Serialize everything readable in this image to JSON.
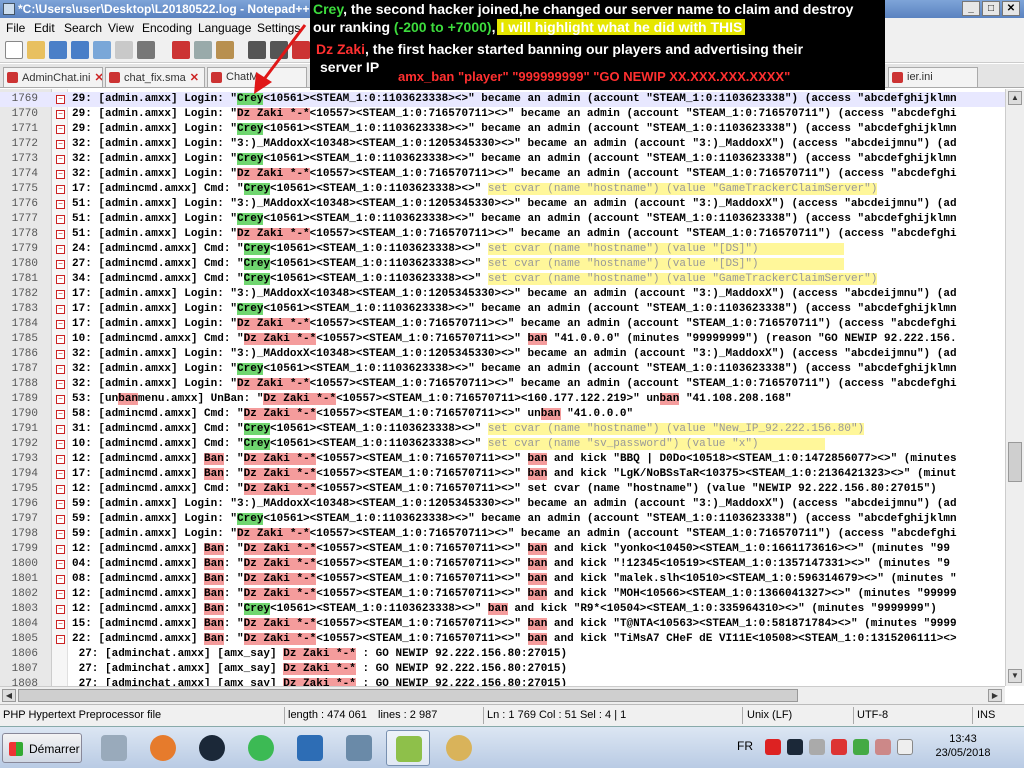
{
  "window": {
    "title": "*C:\\Users\\user\\Desktop\\L20180522.log - Notepad++",
    "min": "_",
    "max": "□",
    "close": "✕"
  },
  "menu": [
    "File",
    "Edit",
    "Search",
    "View",
    "Encoding",
    "Language",
    "Settings"
  ],
  "tabs": [
    {
      "label": "AdminChat.ini"
    },
    {
      "label": "chat_fix.sma"
    },
    {
      "label": "ChatM"
    },
    {
      "label": "ier.ini"
    }
  ],
  "annotation": {
    "line1_name": "Crey",
    "line1_text": ", the second hacker joined,he changed our server name to claim and destroy",
    "line2_pre": "our ranking ",
    "line2_range": "(-200 to +7000)",
    "line2_comma": ",",
    "line2_box": "I will highlight what he did with THIS",
    "line3_name": "Dz Zaki",
    "line3_text": ", the first hacker started banning our players and advertising their",
    "line4_text": "server IP",
    "line5_cmd": "amx_ban \"player\" \"999999999\" \"GO NEWIP XX.XXX.XXX.XXXX\""
  },
  "editor": {
    "lines": [
      {
        "n": "1769",
        "segs": [
          [
            "29: [admin.amxx] Login: \"",
            ""
          ],
          [
            "Crey",
            "g"
          ],
          [
            "<10561><STEAM_1:0:1103623338><>\" became an admin (account \"STEAM_1:0:1103623338\") (access \"abcdefghijklmn",
            ""
          ]
        ]
      },
      {
        "n": "1770",
        "segs": [
          [
            "29: [admin.amxx] Login: \"",
            ""
          ],
          [
            "Dz Zaki *-*",
            "r"
          ],
          [
            "<10557><STEAM_1:0:716570711><>\" became an admin (account \"STEAM_1:0:716570711\") (access \"abcdefghi",
            ""
          ]
        ]
      },
      {
        "n": "1771",
        "segs": [
          [
            "29: [admin.amxx] Login: \"",
            ""
          ],
          [
            "Crey",
            "g"
          ],
          [
            "<10561><STEAM_1:0:1103623338><>\" became an admin (account \"STEAM_1:0:1103623338\") (access \"abcdefghijklmn",
            ""
          ]
        ]
      },
      {
        "n": "1772",
        "segs": [
          [
            "32: [admin.amxx] Login: \"3:)_MAddoxX<10348><STEAM_1:0:1205345330><>\" became an admin (account \"3:)_MaddoxX\") (access \"abcdeijmnu\") (ad",
            ""
          ]
        ]
      },
      {
        "n": "1773",
        "segs": [
          [
            "32: [admin.amxx] Login: \"",
            ""
          ],
          [
            "Crey",
            "g"
          ],
          [
            "<10561><STEAM_1:0:1103623338><>\" became an admin (account \"STEAM_1:0:1103623338\") (access \"abcdefghijklmn",
            ""
          ]
        ]
      },
      {
        "n": "1774",
        "segs": [
          [
            "32: [admin.amxx] Login: \"",
            ""
          ],
          [
            "Dz Zaki *-*",
            "r"
          ],
          [
            "<10557><STEAM_1:0:716570711><>\" became an admin (account \"STEAM_1:0:716570711\") (access \"abcdefghi",
            ""
          ]
        ]
      },
      {
        "n": "1775",
        "segs": [
          [
            "17: [admincmd.amxx] Cmd: \"",
            ""
          ],
          [
            "Crey",
            "g"
          ],
          [
            "<10561><STEAM_1:0:1103623338><>\" ",
            ""
          ],
          [
            "set cvar (name \"hostname\") (value \"GameTrackerClaimServer\")",
            "y"
          ]
        ]
      },
      {
        "n": "1776",
        "segs": [
          [
            "51: [admin.amxx] Login: \"3:)_MAddoxX<10348><STEAM_1:0:1205345330><>\" became an admin (account \"3:)_MaddoxX\") (access \"abcdeijmnu\") (ad",
            ""
          ]
        ]
      },
      {
        "n": "1777",
        "segs": [
          [
            "51: [admin.amxx] Login: \"",
            ""
          ],
          [
            "Crey",
            "g"
          ],
          [
            "<10561><STEAM_1:0:1103623338><>\" became an admin (account \"STEAM_1:0:1103623338\") (access \"abcdefghijklmn",
            ""
          ]
        ]
      },
      {
        "n": "1778",
        "segs": [
          [
            "51: [admin.amxx] Login: \"",
            ""
          ],
          [
            "Dz Zaki *-*",
            "r"
          ],
          [
            "<10557><STEAM_1:0:716570711><>\" became an admin (account \"STEAM_1:0:716570711\") (access \"abcdefghi",
            ""
          ]
        ]
      },
      {
        "n": "1779",
        "segs": [
          [
            "24: [admincmd.amxx] Cmd: \"",
            ""
          ],
          [
            "Crey",
            "g"
          ],
          [
            "<10561><STEAM_1:0:1103623338><>\" ",
            ""
          ],
          [
            "set cvar (name \"hostname\") (value \"[DS]\")             ",
            "y"
          ]
        ]
      },
      {
        "n": "1780",
        "segs": [
          [
            "27: [admincmd.amxx] Cmd: \"",
            ""
          ],
          [
            "Crey",
            "g"
          ],
          [
            "<10561><STEAM_1:0:1103623338><>\" ",
            ""
          ],
          [
            "set cvar (name \"hostname\") (value \"[DS]\")             ",
            "y"
          ]
        ]
      },
      {
        "n": "1781",
        "segs": [
          [
            "34: [admincmd.amxx] Cmd: \"",
            ""
          ],
          [
            "Crey",
            "g"
          ],
          [
            "<10561><STEAM_1:0:1103623338><>\" ",
            ""
          ],
          [
            "set cvar (name \"hostname\") (value \"GameTrackerClaimServer\")",
            "y"
          ]
        ]
      },
      {
        "n": "1782",
        "segs": [
          [
            "17: [admin.amxx] Login: \"3:)_MAddoxX<10348><STEAM_1:0:1205345330><>\" became an admin (account \"3:)_MaddoxX\") (access \"abcdeijmnu\") (ad",
            ""
          ]
        ]
      },
      {
        "n": "1783",
        "segs": [
          [
            "17: [admin.amxx] Login: \"",
            ""
          ],
          [
            "Crey",
            "g"
          ],
          [
            "<10561><STEAM_1:0:1103623338><>\" became an admin (account \"STEAM_1:0:1103623338\") (access \"abcdefghijklmn",
            ""
          ]
        ]
      },
      {
        "n": "1784",
        "segs": [
          [
            "17: [admin.amxx] Login: \"",
            ""
          ],
          [
            "Dz Zaki *-*",
            "r"
          ],
          [
            "<10557><STEAM_1:0:716570711><>\" became an admin (account \"STEAM_1:0:716570711\") (access \"abcdefghi",
            ""
          ]
        ]
      },
      {
        "n": "1785",
        "segs": [
          [
            "10: [admincmd.amxx] Cmd: \"",
            ""
          ],
          [
            "Dz Zaki *-*",
            "r"
          ],
          [
            "<10557><STEAM_1:0:716570711><>\" ",
            ""
          ],
          [
            "ban",
            "r"
          ],
          [
            " \"41.0.0.0\" (minutes \"99999999\") (reason \"GO NEWIP 92.222.156.",
            ""
          ]
        ]
      },
      {
        "n": "1786",
        "segs": [
          [
            "32: [admin.amxx] Login: \"3:)_MAddoxX<10348><STEAM_1:0:1205345330><>\" became an admin (account \"3:)_MaddoxX\") (access \"abcdeijmnu\") (ad",
            ""
          ]
        ]
      },
      {
        "n": "1787",
        "segs": [
          [
            "32: [admin.amxx] Login: \"",
            ""
          ],
          [
            "Crey",
            "g"
          ],
          [
            "<10561><STEAM_1:0:1103623338><>\" became an admin (account \"STEAM_1:0:1103623338\") (access \"abcdefghijklmn",
            ""
          ]
        ]
      },
      {
        "n": "1788",
        "segs": [
          [
            "32: [admin.amxx] Login: \"",
            ""
          ],
          [
            "Dz Zaki *-*",
            "r"
          ],
          [
            "<10557><STEAM_1:0:716570711><>\" became an admin (account \"STEAM_1:0:716570711\") (access \"abcdefghi",
            ""
          ]
        ]
      },
      {
        "n": "1789",
        "segs": [
          [
            "53: [un",
            ""
          ],
          [
            "ban",
            "r"
          ],
          [
            "menu.amxx] UnBan: \"",
            ""
          ],
          [
            "Dz Zaki *-*",
            "r"
          ],
          [
            "<10557><STEAM_1:0:716570711><160.177.122.219>\" un",
            ""
          ],
          [
            "ban",
            "r"
          ],
          [
            " \"41.108.208.168\"",
            ""
          ]
        ]
      },
      {
        "n": "1790",
        "segs": [
          [
            "58: [admincmd.amxx] Cmd: \"",
            ""
          ],
          [
            "Dz Zaki *-*",
            "r"
          ],
          [
            "<10557><STEAM_1:0:716570711><>\" un",
            ""
          ],
          [
            "ban",
            "r"
          ],
          [
            " \"41.0.0.0\"",
            ""
          ]
        ]
      },
      {
        "n": "1791",
        "segs": [
          [
            "31: [admincmd.amxx] Cmd: \"",
            ""
          ],
          [
            "Crey",
            "g"
          ],
          [
            "<10561><STEAM_1:0:1103623338><>\" ",
            ""
          ],
          [
            "set cvar (name \"hostname\") (value \"New_IP_92.222.156.80\")",
            "y"
          ]
        ]
      },
      {
        "n": "1792",
        "segs": [
          [
            "10: [admincmd.amxx] Cmd: \"",
            ""
          ],
          [
            "Crey",
            "g"
          ],
          [
            "<10561><STEAM_1:0:1103623338><>\" ",
            ""
          ],
          [
            "set cvar (name \"sv_password\") (value \"x\")          ",
            "y"
          ]
        ]
      },
      {
        "n": "1793",
        "segs": [
          [
            "12: [admincmd.amxx] ",
            ""
          ],
          [
            "Ban",
            "r"
          ],
          [
            ": \"",
            ""
          ],
          [
            "Dz Zaki *-*",
            "r"
          ],
          [
            "<10557><STEAM_1:0:716570711><>\" ",
            ""
          ],
          [
            "ban",
            "r"
          ],
          [
            " and kick \"BBQ | D0Do<10518><STEAM_1:0:1472856077><>\" (minutes",
            ""
          ]
        ]
      },
      {
        "n": "1794",
        "segs": [
          [
            "17: [admincmd.amxx] ",
            ""
          ],
          [
            "Ban",
            "r"
          ],
          [
            ": \"",
            ""
          ],
          [
            "Dz Zaki *-*",
            "r"
          ],
          [
            "<10557><STEAM_1:0:716570711><>\" ",
            ""
          ],
          [
            "ban",
            "r"
          ],
          [
            " and kick \"LgK/NoBSsTaR<10375><STEAM_1:0:2136421323><>\" (minut",
            ""
          ]
        ]
      },
      {
        "n": "1795",
        "segs": [
          [
            "12: [admincmd.amxx] Cmd: \"",
            ""
          ],
          [
            "Dz Zaki *-*",
            "r"
          ],
          [
            "<10557><STEAM_1:0:716570711><>\" set cvar (name \"hostname\") (value \"NEWIP 92.222.156.80:27015\")",
            ""
          ]
        ]
      },
      {
        "n": "1796",
        "segs": [
          [
            "59: [admin.amxx] Login: \"3:)_MAddoxX<10348><STEAM_1:0:1205345330><>\" became an admin (account \"3:)_MaddoxX\") (access \"abcdeijmnu\") (ad",
            ""
          ]
        ]
      },
      {
        "n": "1797",
        "segs": [
          [
            "59: [admin.amxx] Login: \"",
            ""
          ],
          [
            "Crey",
            "g"
          ],
          [
            "<10561><STEAM_1:0:1103623338><>\" became an admin (account \"STEAM_1:0:1103623338\") (access \"abcdefghijklmn",
            ""
          ]
        ]
      },
      {
        "n": "1798",
        "segs": [
          [
            "59: [admin.amxx] Login: \"",
            ""
          ],
          [
            "Dz Zaki *-*",
            "r"
          ],
          [
            "<10557><STEAM_1:0:716570711><>\" became an admin (account \"STEAM_1:0:716570711\") (access \"abcdefghi",
            ""
          ]
        ]
      },
      {
        "n": "1799",
        "segs": [
          [
            "12: [admincmd.amxx] ",
            ""
          ],
          [
            "Ban",
            "r"
          ],
          [
            ": \"",
            ""
          ],
          [
            "Dz Zaki *-*",
            "r"
          ],
          [
            "<10557><STEAM_1:0:716570711><>\" ",
            ""
          ],
          [
            "ban",
            "r"
          ],
          [
            " and kick \"yonko<10450><STEAM_1:0:1661173616><>\" (minutes \"99",
            ""
          ]
        ]
      },
      {
        "n": "1800",
        "segs": [
          [
            "04: [admincmd.amxx] ",
            ""
          ],
          [
            "Ban",
            "r"
          ],
          [
            ": \"",
            ""
          ],
          [
            "Dz Zaki *-*",
            "r"
          ],
          [
            "<10557><STEAM_1:0:716570711><>\" ",
            ""
          ],
          [
            "ban",
            "r"
          ],
          [
            " and kick \"!12345<10519><STEAM_1:0:1357147331><>\" (minutes \"9",
            ""
          ]
        ]
      },
      {
        "n": "1801",
        "segs": [
          [
            "08: [admincmd.amxx] ",
            ""
          ],
          [
            "Ban",
            "r"
          ],
          [
            ": \"",
            ""
          ],
          [
            "Dz Zaki *-*",
            "r"
          ],
          [
            "<10557><STEAM_1:0:716570711><>\" ",
            ""
          ],
          [
            "ban",
            "r"
          ],
          [
            " and kick \"malek.slh<10510><STEAM_1:0:596314679><>\" (minutes \"",
            ""
          ]
        ]
      },
      {
        "n": "1802",
        "segs": [
          [
            "12: [admincmd.amxx] ",
            ""
          ],
          [
            "Ban",
            "r"
          ],
          [
            ": \"",
            ""
          ],
          [
            "Dz Zaki *-*",
            "r"
          ],
          [
            "<10557><STEAM_1:0:716570711><>\" ",
            ""
          ],
          [
            "ban",
            "r"
          ],
          [
            " and kick \"MOH<10566><STEAM_1:0:1366041327><>\" (minutes \"99999",
            ""
          ]
        ]
      },
      {
        "n": "1803",
        "segs": [
          [
            "12: [admincmd.amxx] ",
            ""
          ],
          [
            "Ban",
            "r"
          ],
          [
            ": \"",
            ""
          ],
          [
            "Crey",
            "g"
          ],
          [
            "<10561><STEAM_1:0:1103623338><>\" ",
            ""
          ],
          [
            "ban",
            "r"
          ],
          [
            " and kick \"R9*<10504><STEAM_1:0:335964310><>\" (minutes \"9999999\")",
            ""
          ]
        ]
      },
      {
        "n": "1804",
        "segs": [
          [
            "15: [admincmd.amxx] ",
            ""
          ],
          [
            "Ban",
            "r"
          ],
          [
            ": \"",
            ""
          ],
          [
            "Dz Zaki *-*",
            "r"
          ],
          [
            "<10557><STEAM_1:0:716570711><>\" ",
            ""
          ],
          [
            "ban",
            "r"
          ],
          [
            " and kick \"T@NTA<10563><STEAM_1:0:581871784><>\" (minutes \"9999",
            ""
          ]
        ]
      },
      {
        "n": "1805",
        "segs": [
          [
            "22: [admincmd.amxx] ",
            ""
          ],
          [
            "Ban",
            "r"
          ],
          [
            ": \"",
            ""
          ],
          [
            "Dz Zaki *-*",
            "r"
          ],
          [
            "<10557><STEAM_1:0:716570711><>\" ",
            ""
          ],
          [
            "ban",
            "r"
          ],
          [
            " and kick \"TiMsA7 CHeF dE VI11E<10508><STEAM_1:0:1315206111><>",
            ""
          ]
        ]
      },
      {
        "n": "1806",
        "segs": [
          [
            " 27: [adminchat.amxx] [amx_say] ",
            ""
          ],
          [
            "Dz Zaki *-*",
            "r"
          ],
          [
            " : GO NEWIP 92.222.156.80:27015)",
            ""
          ]
        ]
      },
      {
        "n": "1807",
        "segs": [
          [
            " 27: [adminchat.amxx] [amx_say] ",
            ""
          ],
          [
            "Dz Zaki *-*",
            "r"
          ],
          [
            " : GO NEWIP 92.222.156.80:27015)",
            ""
          ]
        ]
      },
      {
        "n": "1808",
        "segs": [
          [
            " 27: [adminchat.amxx] [amx_say] ",
            ""
          ],
          [
            "Dz Zaki *-*",
            "r"
          ],
          [
            " : GO NEWIP 92.222.156.80:27015)",
            ""
          ]
        ]
      }
    ]
  },
  "status": {
    "filetype": "PHP Hypertext Preprocessor file",
    "length": "length : 474 061",
    "lines": "lines : 2 987",
    "position": "Ln : 1 769    Col : 51    Sel : 4 | 1",
    "eol": "Unix (LF)",
    "encoding": "UTF-8",
    "mode": "INS"
  },
  "taskbar": {
    "start": "Démarrer",
    "lang": "FR",
    "time": "13:43",
    "date": "23/05/2018"
  }
}
